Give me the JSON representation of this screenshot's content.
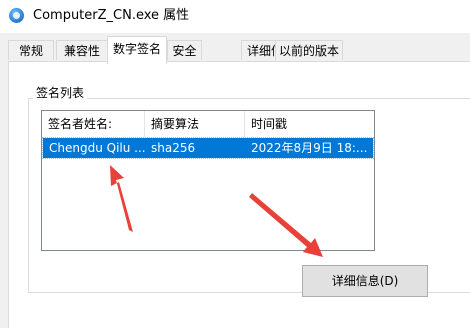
{
  "window": {
    "title": "ComputerZ_CN.exe 属性"
  },
  "tabs": [
    {
      "label": "常规"
    },
    {
      "label": "兼容性"
    },
    {
      "label": "数字签名"
    },
    {
      "label": "安全"
    },
    {
      "label": "详细信息"
    },
    {
      "label": "以前的版本"
    }
  ],
  "active_tab": "数字签名",
  "signature_list": {
    "legend": "签名列表",
    "columns": [
      "签名者姓名:",
      "摘要算法",
      "时间戳"
    ],
    "rows": [
      {
        "signer": "Chengdu Qilu ...",
        "digest": "sha256",
        "timestamp": "2022年8月9日 18:..."
      }
    ]
  },
  "details_button": {
    "label": "详细信息(D)"
  },
  "colors": {
    "selection": "#0078d7",
    "annotation_arrow": "#e8413a",
    "window_bg": "#f0f0f0"
  }
}
